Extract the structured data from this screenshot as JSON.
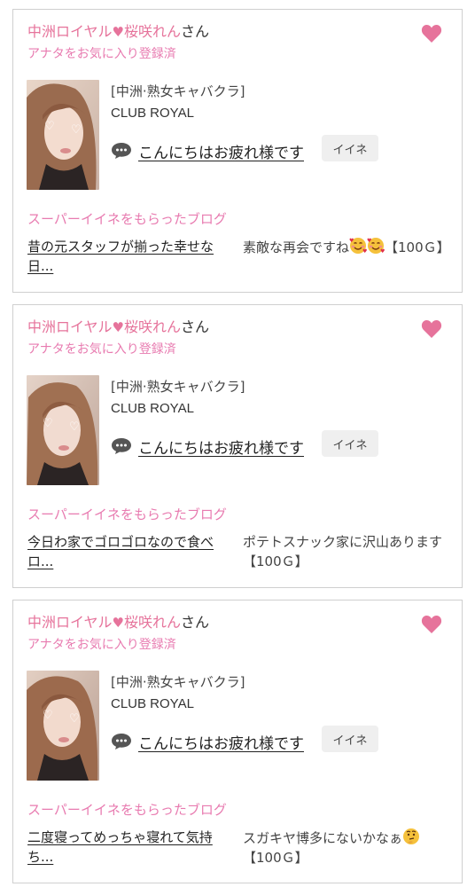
{
  "cards": [
    {
      "name": "中洲ロイヤル♥桜咲れん",
      "name_prefix": "中洲ロイヤル",
      "name_suffix": "桜咲れん",
      "honorific": "さん",
      "fav_status": "アナタをお気に入り登録済",
      "shop_category": "[中洲·熟女キャバクラ]",
      "shop_name": "CLUB ROYAL",
      "message": "こんにちはお疲れ様です",
      "like_label": "イイネ",
      "blog_header": "スーパーイイネをもらったブログ",
      "blog_title": "昔の元スタッフが揃った幸せな日...",
      "blog_comment": "素敵な再会ですね",
      "blog_comment_after": "【100Ｇ】",
      "emojis": [
        "smiling-face-with-hearts-emoji",
        "smiling-face-with-hearts-emoji"
      ]
    },
    {
      "name": "中洲ロイヤル♥桜咲れん",
      "name_prefix": "中洲ロイヤル",
      "name_suffix": "桜咲れん",
      "honorific": "さん",
      "fav_status": "アナタをお気に入り登録済",
      "shop_category": "[中洲·熟女キャバクラ]",
      "shop_name": "CLUB ROYAL",
      "message": "こんにちはお疲れ様です",
      "like_label": "イイネ",
      "blog_header": "スーパーイイネをもらったブログ",
      "blog_title": "今日わ家でゴロゴロなので食べロ...",
      "blog_comment": "ポテトスナック家に沢山あります【100Ｇ】",
      "emojis": []
    },
    {
      "name": "中洲ロイヤル♥桜咲れん",
      "name_prefix": "中洲ロイヤル",
      "name_suffix": "桜咲れん",
      "honorific": "さん",
      "fav_status": "アナタをお気に入り登録済",
      "shop_category": "[中洲·熟女キャバクラ]",
      "shop_name": "CLUB ROYAL",
      "message": "こんにちはお疲れ様です",
      "like_label": "イイネ",
      "blog_header": "スーパーイイネをもらったブログ",
      "blog_title": "二度寝ってめっちゃ寝れて気持ち...",
      "blog_comment": "スガキヤ博多にないかなぁ",
      "blog_comment_after": "【100Ｇ】",
      "emojis": [
        "thinking-face-emoji"
      ]
    }
  ],
  "colors": {
    "pink": "#e6739b",
    "fav_pink": "#e87bb0",
    "border": "#cfcfcf",
    "like_bg": "#efefef"
  },
  "icons": {
    "favorite": "heart-icon",
    "message": "speech-bubble-icon"
  }
}
